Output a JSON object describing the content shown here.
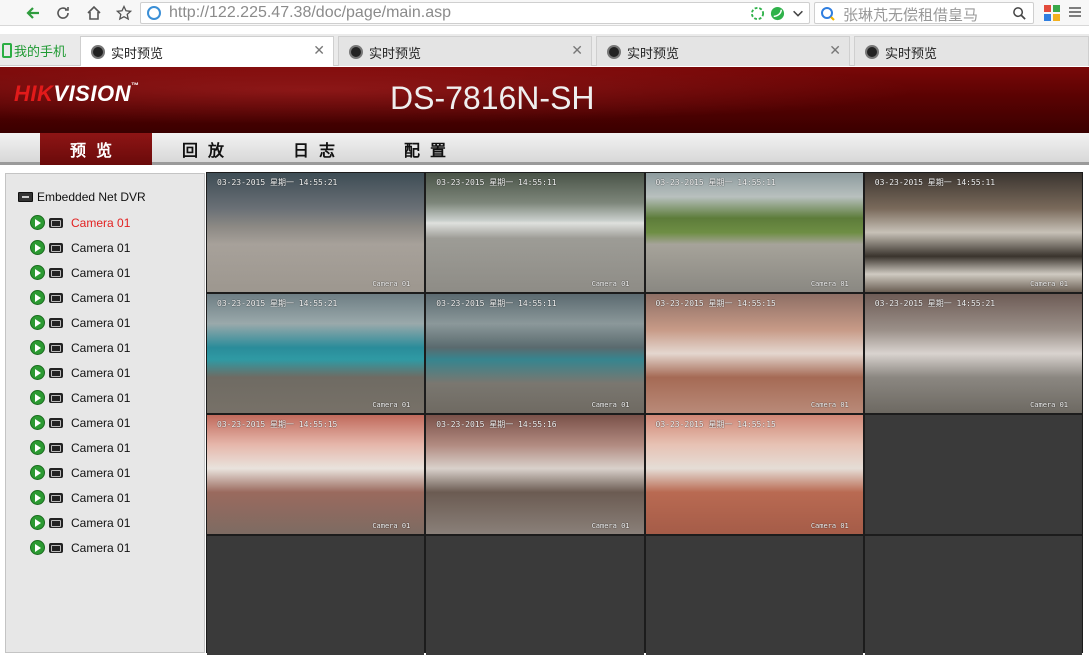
{
  "browser": {
    "url": "http://122.225.47.38/doc/page/main.asp",
    "search_placeholder": "张琳芃无偿租借皇马",
    "tabs": [
      {
        "label": "实时预览"
      },
      {
        "label": "实时预览"
      },
      {
        "label": "实时预览"
      },
      {
        "label": "实时预览"
      }
    ],
    "phone_label": "我的手机"
  },
  "header": {
    "brand_hik": "HIK",
    "brand_vision": "VISION",
    "brand_tm": "™",
    "model": "DS-7816N-SH"
  },
  "nav": {
    "items": [
      {
        "label": "预览"
      },
      {
        "label": "回放"
      },
      {
        "label": "日志"
      },
      {
        "label": "配置"
      }
    ],
    "active_index": 0
  },
  "sidebar": {
    "root_label": "Embedded Net DVR",
    "cameras": [
      {
        "label": "Camera 01"
      },
      {
        "label": "Camera 01"
      },
      {
        "label": "Camera 01"
      },
      {
        "label": "Camera 01"
      },
      {
        "label": "Camera 01"
      },
      {
        "label": "Camera 01"
      },
      {
        "label": "Camera 01"
      },
      {
        "label": "Camera 01"
      },
      {
        "label": "Camera 01"
      },
      {
        "label": "Camera 01"
      },
      {
        "label": "Camera 01"
      },
      {
        "label": "Camera 01"
      },
      {
        "label": "Camera 01"
      },
      {
        "label": "Camera 01"
      }
    ],
    "selected_index": 0
  },
  "video": {
    "cells": [
      {
        "ts": "03-23-2015 星期一 14:55:21",
        "name": "Camera 01"
      },
      {
        "ts": "03-23-2015 星期一 14:55:11",
        "name": "Camera 01"
      },
      {
        "ts": "03-23-2015 星期一 14:55:11",
        "name": "Camera 01"
      },
      {
        "ts": "03-23-2015 星期一 14:55:11",
        "name": "Camera 01"
      },
      {
        "ts": "03-23-2015 星期一 14:55:21",
        "name": "Camera 01"
      },
      {
        "ts": "03-23-2015 星期一 14:55:11",
        "name": "Camera 01"
      },
      {
        "ts": "03-23-2015 星期一 14:55:15",
        "name": "Camera 01"
      },
      {
        "ts": "03-23-2015 星期一 14:55:21",
        "name": "Camera 01"
      },
      {
        "ts": "03-23-2015 星期一 14:55:15",
        "name": "Camera 01"
      },
      {
        "ts": "03-23-2015 星期一 14:55:16",
        "name": "Camera 01"
      },
      {
        "ts": "03-23-2015 星期一 14:55:15",
        "name": "Camera 01"
      }
    ]
  }
}
